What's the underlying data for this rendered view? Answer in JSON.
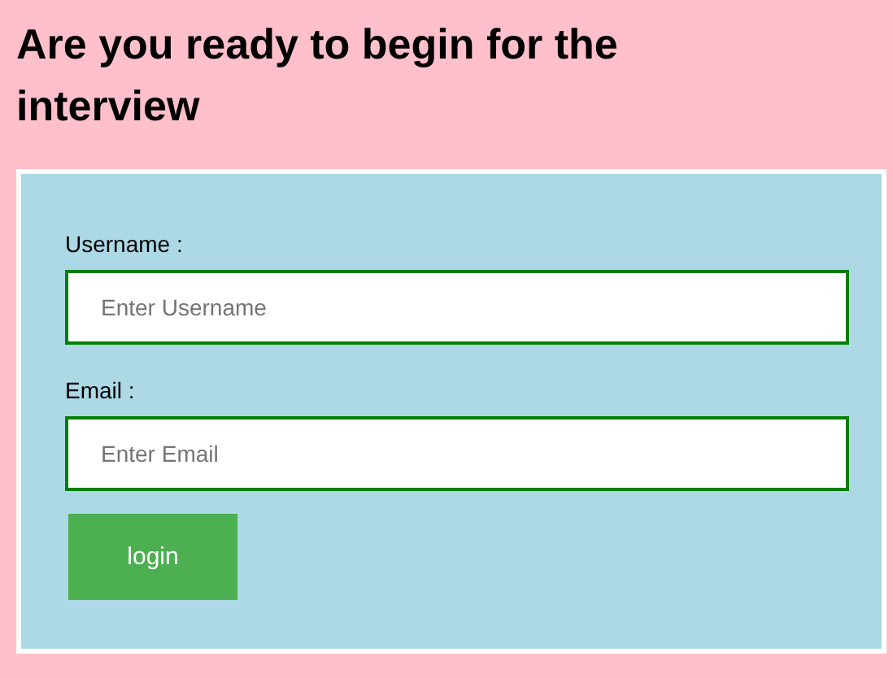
{
  "heading": "Are you ready to begin for the interview",
  "form": {
    "fields": [
      {
        "label": "Username :",
        "placeholder": "Enter Username"
      },
      {
        "label": "Email :",
        "placeholder": "Enter Email"
      }
    ],
    "button": "login"
  }
}
